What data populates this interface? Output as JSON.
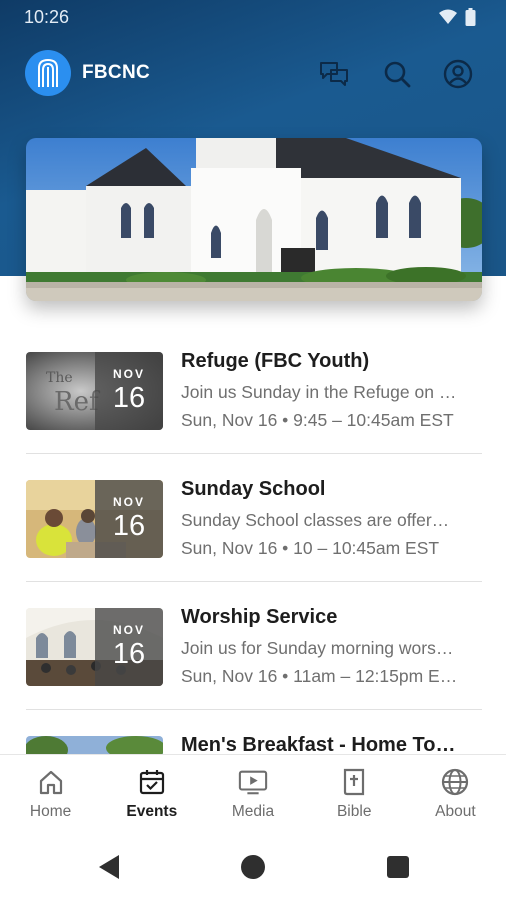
{
  "status_bar": {
    "time": "10:26"
  },
  "app": {
    "title": "FBCNC"
  },
  "colors": {
    "header_top": "#0f3b66",
    "header_bottom": "#1a5688",
    "logo": "#2b8ff0",
    "active_nav": "#1d1d1d",
    "inactive_nav": "#6d6d6d"
  },
  "header_icons": [
    "chat-icon",
    "search-icon",
    "account-icon"
  ],
  "events": [
    {
      "title": "Refuge (FBC Youth)",
      "description": "Join us Sunday in the Refuge on …",
      "time": "Sun, Nov 16 • 9:45 – 10:45am EST",
      "month": "NOV",
      "day": "16"
    },
    {
      "title": "Sunday School",
      "description": "Sunday School classes are offer…",
      "time": "Sun, Nov 16 • 10 – 10:45am EST",
      "month": "NOV",
      "day": "16"
    },
    {
      "title": "Worship Service",
      "description": "Join us for Sunday morning wors…",
      "time": "Sun, Nov 16 • 11am – 12:15pm E…",
      "month": "NOV",
      "day": "16"
    },
    {
      "title": "Men's Breakfast - Home To…"
    }
  ],
  "bottom_nav": {
    "active": "Events",
    "items": [
      {
        "label": "Home",
        "icon": "home-icon"
      },
      {
        "label": "Events",
        "icon": "calendar-icon"
      },
      {
        "label": "Media",
        "icon": "media-icon"
      },
      {
        "label": "Bible",
        "icon": "bible-icon"
      },
      {
        "label": "About",
        "icon": "globe-icon"
      }
    ]
  },
  "system_nav": [
    "back-icon",
    "home-circle-icon",
    "recents-icon"
  ]
}
